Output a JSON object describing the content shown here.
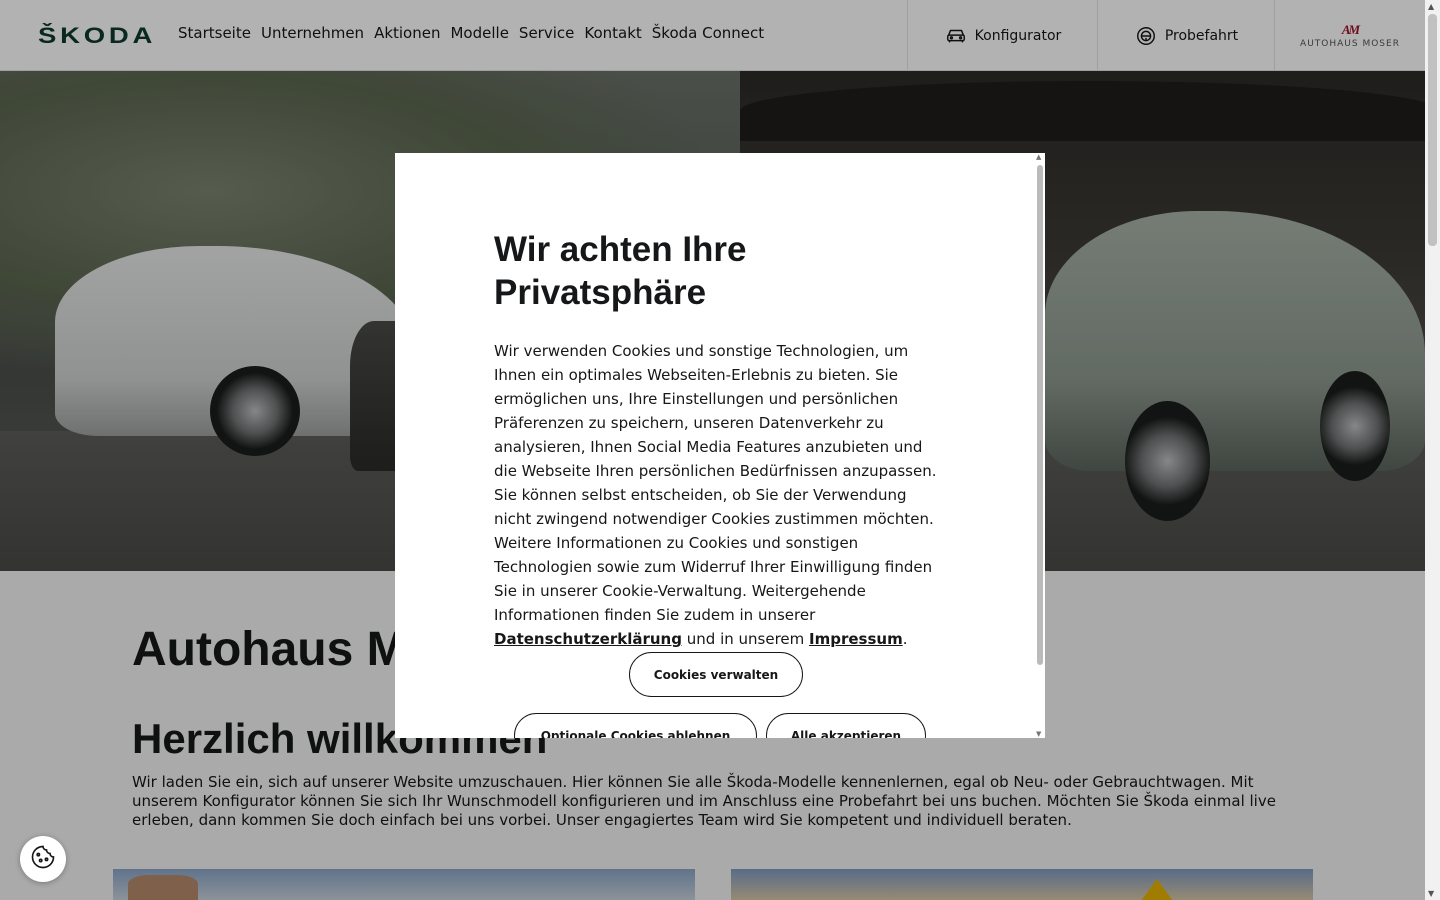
{
  "header": {
    "logo_text": "ŠKODA",
    "nav": [
      "Startseite",
      "Unternehmen",
      "Aktionen",
      "Modelle",
      "Service",
      "Kontakt",
      "Škoda Connect"
    ],
    "configurator_label": "Konfigurator",
    "testdrive_label": "Probefahrt",
    "dealer_logo_mark": "AM",
    "dealer_logo_text": "AUTOHAUS MOSER"
  },
  "content": {
    "heading": "Autohaus Moser",
    "welcome_heading": "Herzlich willkommen",
    "welcome_text": "Wir laden Sie ein, sich auf unserer Website umzuschauen. Hier können Sie alle Škoda-Modelle kennenlernen, egal ob Neu- oder Gebrauchtwagen. Mit unserem Konfigurator können Sie sich Ihr Wunschmodell konfigurieren und im Anschluss eine Probefahrt bei uns buchen. Möchten Sie Škoda einmal live erleben, dann kommen Sie doch einfach bei uns vorbei. Unser engagiertes Team wird Sie kompetent und individuell beraten."
  },
  "cookie_modal": {
    "title": "Wir achten Ihre Privatsphäre",
    "text_before_link": "Wir verwenden Cookies und sonstige Technologien, um Ihnen ein optimales Webseiten-Erlebnis zu bieten. Sie ermöglichen uns, Ihre Einstellungen und persönlichen Präferenzen zu speichern, unseren Datenverkehr zu analysieren, Ihnen Social Media Features anzubieten und die Webseite Ihren persönlichen Bedürfnissen anzupassen. Sie können selbst entscheiden, ob Sie der Verwendung nicht zwingend notwendiger Cookies zustimmen möchten. Weitere Informationen zu Cookies und sonstigen Technologien sowie zum Widerruf Ihrer Einwilligung finden Sie in unserer Cookie-Verwaltung. Weitergehende Informationen finden Sie zudem in unserer",
    "privacy_link": "Datenschutzerklärung",
    "text_between": "und in unserem",
    "imprint_link": "Impressum",
    "text_end": ".",
    "manage_button": "Cookies verwalten",
    "reject_button": "Optionale Cookies ablehnen",
    "accept_button": "Alle akzeptieren"
  },
  "icons": {
    "configurator": "car-icon",
    "testdrive": "steering-wheel-icon",
    "cookie_settings": "cookie-icon"
  },
  "colors": {
    "brand_green": "#0e3a2f",
    "dealer_red": "#a0132a"
  }
}
